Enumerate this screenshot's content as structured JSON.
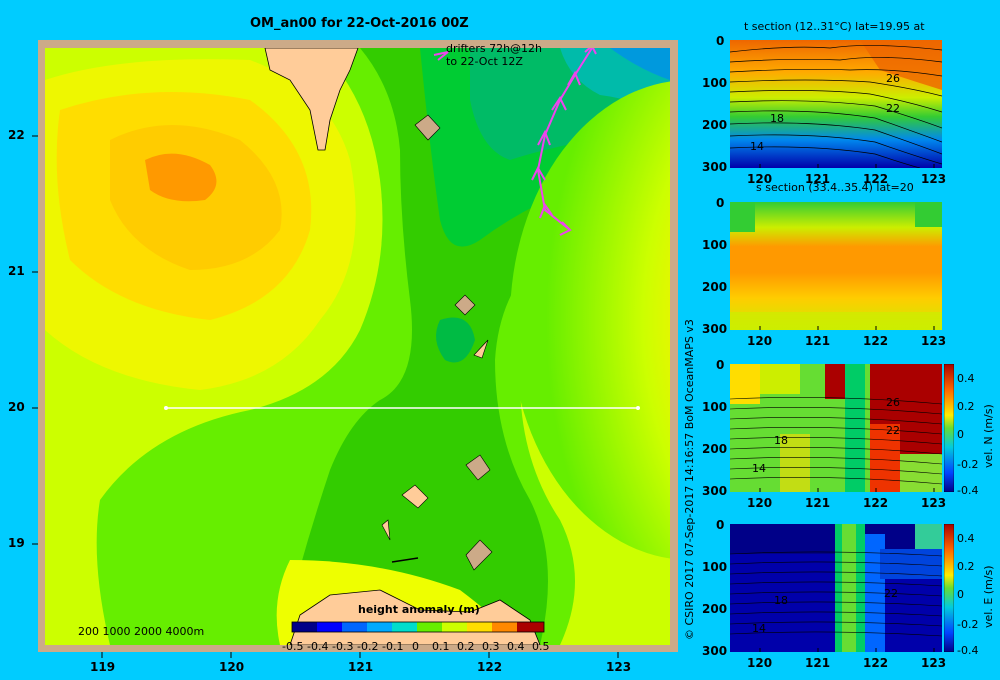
{
  "main": {
    "title": "OM_an00 for 22-Oct-2016 00Z",
    "drifters_line1": "drifters 72h@12h",
    "drifters_line2": "to 22-Oct 12Z",
    "depth_legend": "200  1000  2000  4000m",
    "colorbar_title": "height anomaly (m)",
    "colorbar_ticks": [
      "-0.5",
      "-0.4",
      "-0.3",
      "-0.2",
      "-0.1",
      "0",
      "0.1",
      "0.2",
      "0.3",
      "0.4",
      "0.5"
    ],
    "x_ticks": [
      "119",
      "120",
      "121",
      "122",
      "123"
    ],
    "y_ticks": [
      "22",
      "21",
      "20",
      "19"
    ]
  },
  "side": {
    "credit": "© CSIRO 2017   07-Sep-2017 14:16:57 BoM OceanMAPS v3",
    "x_ticks": [
      "120",
      "121",
      "122",
      "123"
    ],
    "y_ticks": [
      "0",
      "100",
      "200",
      "300"
    ],
    "panels": [
      {
        "title": "t section (12..31°C) lat=19.95 at",
        "contour_labels": [
          "26",
          "22",
          "18",
          "14"
        ]
      },
      {
        "title": "s section (33.4..35.4) lat=20",
        "contour_labels": []
      },
      {
        "title": "",
        "colorbar_label": "vel. N  (m/s)",
        "colorbar_ticks": [
          "0.4",
          "0.2",
          "0",
          "-0.2",
          "-0.4"
        ],
        "contour_labels": [
          "26",
          "22",
          "18",
          "14"
        ]
      },
      {
        "title": "",
        "colorbar_label": "vel. E  (m/s)",
        "colorbar_ticks": [
          "0.4",
          "0.2",
          "0",
          "-0.2",
          "-0.4"
        ],
        "contour_labels": [
          "22",
          "18",
          "14"
        ]
      }
    ]
  },
  "chart_data": [
    {
      "type": "heatmap",
      "title": "OM_an00 for 22-Oct-2016 00Z",
      "xlabel": "",
      "ylabel": "",
      "xlim": [
        118.5,
        123.5
      ],
      "ylim": [
        18.3,
        22.7
      ],
      "x_ticks": [
        119,
        120,
        121,
        122,
        123
      ],
      "y_ticks": [
        19,
        20,
        21,
        22
      ],
      "colorbar": {
        "label": "height anomaly (m)",
        "range": [
          -0.5,
          0.5
        ]
      },
      "section_line": {
        "lat": 20,
        "lon_start": 119.5,
        "lon_end": 123.2
      }
    },
    {
      "type": "heatmap",
      "title": "t section (12..31°C) lat=19.95 at",
      "xlim": [
        119.6,
        123.2
      ],
      "ylim": [
        300,
        0
      ]
    },
    {
      "type": "heatmap",
      "title": "s section (33.4..35.4) lat=20",
      "xlim": [
        119.6,
        123.2
      ],
      "ylim": [
        300,
        0
      ]
    },
    {
      "type": "heatmap",
      "xlim": [
        119.6,
        123.2
      ],
      "ylim": [
        300,
        0
      ],
      "colorbar": {
        "label": "vel. N  (m/s)",
        "range": [
          -0.4,
          0.4
        ]
      }
    },
    {
      "type": "heatmap",
      "xlim": [
        119.6,
        123.2
      ],
      "ylim": [
        300,
        0
      ],
      "colorbar": {
        "label": "vel. E  (m/s)",
        "range": [
          -0.4,
          0.4
        ]
      }
    }
  ]
}
